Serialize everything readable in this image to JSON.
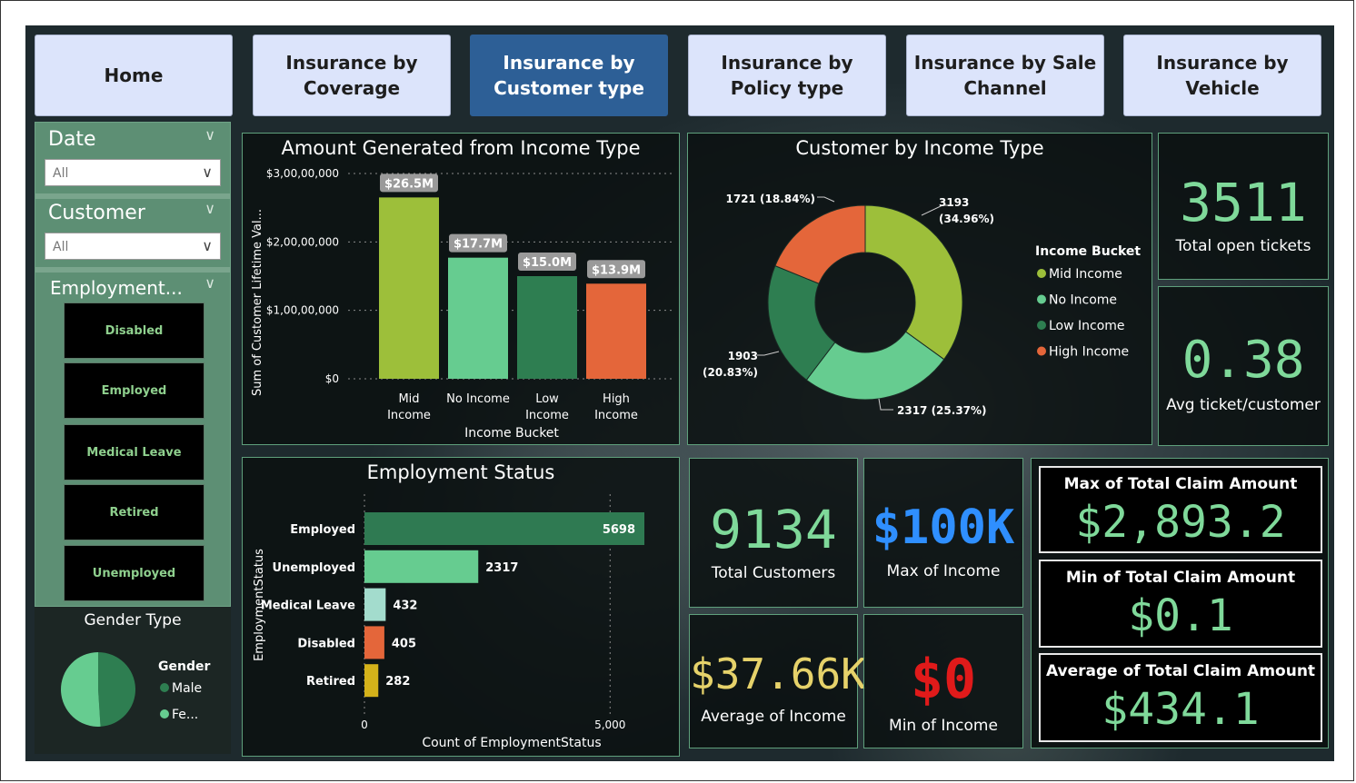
{
  "nav": {
    "tabs": [
      {
        "label": "Home"
      },
      {
        "label": "Insurance by Coverage"
      },
      {
        "label": "Insurance by Customer type"
      },
      {
        "label": "Insurance by Policy type"
      },
      {
        "label": "Insurance by Sale Channel"
      },
      {
        "label": "Insurance by Vehicle"
      }
    ],
    "active_tab": "Insurance by Customer type"
  },
  "filters": {
    "date": {
      "title": "Date",
      "value": "All"
    },
    "customer": {
      "title": "Customer",
      "value": "All"
    },
    "employment": {
      "title": "Employment...",
      "options": [
        "Disabled",
        "Employed",
        "Medical Leave",
        "Retired",
        "Unemployed"
      ]
    }
  },
  "gender": {
    "title": "Gender Type",
    "legend_title": "Gender",
    "legend": [
      {
        "label": "Male",
        "color": "#2e7e51"
      },
      {
        "label": "Fe...",
        "color": "#66cc90"
      }
    ]
  },
  "kpis": {
    "open_tickets": {
      "value": "3511",
      "label": "Total open tickets"
    },
    "avg_ticket": {
      "value": "0.38",
      "label": "Avg ticket/customer"
    },
    "total_customers": {
      "value": "9134",
      "label": "Total Customers"
    },
    "max_income": {
      "value": "$100K",
      "label": "Max of Income"
    },
    "avg_income": {
      "value": "$37.66K",
      "label": "Average of Income"
    },
    "min_income": {
      "value": "$0",
      "label": "Min of Income"
    },
    "max_claim": {
      "label": "Max of Total Claim Amount",
      "value": "$2,893.2"
    },
    "min_claim": {
      "label": "Min of Total Claim Amount",
      "value": "$0.1"
    },
    "avg_claim": {
      "label": "Average of Total Claim Amount",
      "value": "$434.1"
    }
  },
  "colors": {
    "mid_income": "#9dbf3a",
    "no_income": "#66cc90",
    "low_income": "#2e7e51",
    "high_income": "#e4663a",
    "kpi_green": "#7fd99a",
    "kpi_blue": "#2f8fff",
    "kpi_yellow": "#e6d26a",
    "kpi_red": "#e01a1a"
  },
  "chart_data": [
    {
      "type": "bar",
      "title": "Amount Generated from Income Type",
      "xlabel": "Income Bucket",
      "ylabel": "Sum of Customer Lifetime Val...",
      "categories": [
        "Mid Income",
        "No Income",
        "Low Income",
        "High Income"
      ],
      "values": [
        26500000,
        17700000,
        15000000,
        13900000
      ],
      "data_labels": [
        "$26.5M",
        "$17.7M",
        "$15.0M",
        "$13.9M"
      ],
      "y_ticks": [
        "$0",
        "$1,00,00,000",
        "$2,00,00,000",
        "$3,00,00,000"
      ],
      "ylim": [
        0,
        30000000
      ],
      "colors": [
        "#9dbf3a",
        "#66cc90",
        "#2e7e51",
        "#e4663a"
      ]
    },
    {
      "type": "pie",
      "title": "Customer by Income Type",
      "legend_title": "Income Bucket",
      "labels": [
        "Mid Income",
        "No Income",
        "Low Income",
        "High Income"
      ],
      "values": [
        3193,
        2317,
        1903,
        1721
      ],
      "percent_labels": [
        "3193 (34.96%)",
        "2317 (25.37%)",
        "1903 (20.83%)",
        "1721 (18.84%)"
      ],
      "colors": [
        "#9dbf3a",
        "#66cc90",
        "#2e7e51",
        "#e4663a"
      ],
      "donut": true
    },
    {
      "type": "bar",
      "orientation": "horizontal",
      "title": "Employment Status",
      "xlabel": "Count of EmploymentStatus",
      "ylabel": "EmploymentStatus",
      "categories": [
        "Employed",
        "Unemployed",
        "Medical Leave",
        "Disabled",
        "Retired"
      ],
      "values": [
        5698,
        2317,
        432,
        405,
        282
      ],
      "x_ticks": [
        "0",
        "5,000"
      ],
      "xlim": [
        0,
        5698
      ],
      "colors": [
        "#2f7a52",
        "#66cc90",
        "#a3dccd",
        "#e4663a",
        "#d4b21a"
      ]
    },
    {
      "type": "pie",
      "title": "Gender Type",
      "labels": [
        "Male",
        "Fe..."
      ],
      "values": [
        49,
        51
      ],
      "colors": [
        "#2e7e51",
        "#66cc90"
      ]
    }
  ]
}
